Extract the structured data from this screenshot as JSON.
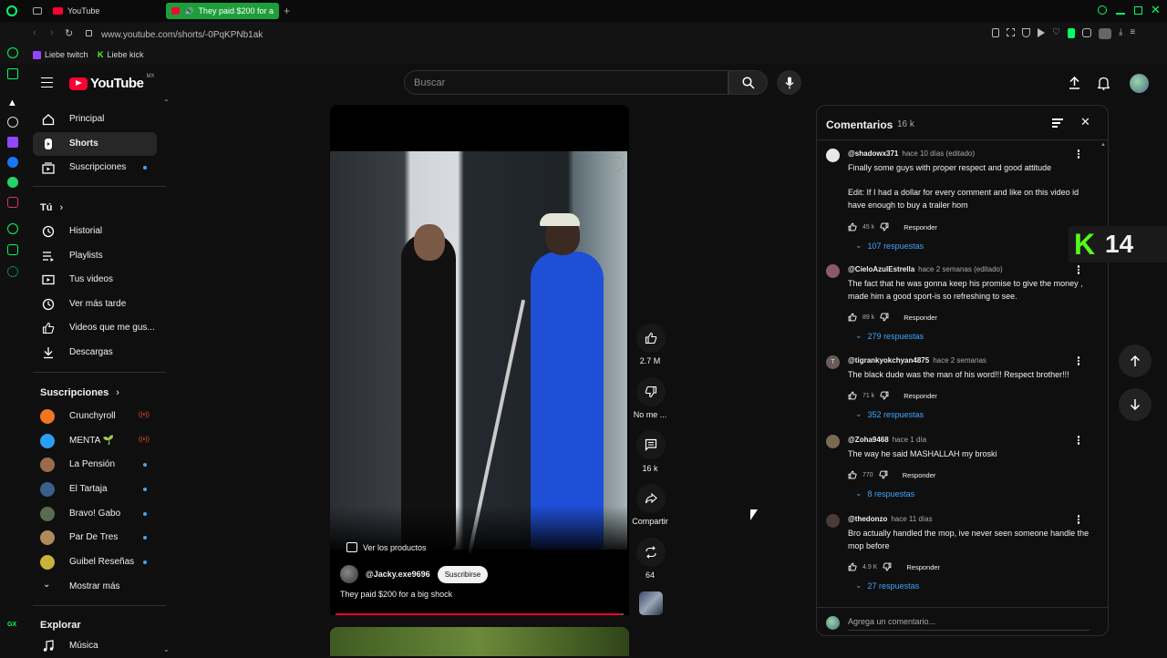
{
  "browser": {
    "tabs": [
      {
        "label": "YouTube",
        "active": false
      },
      {
        "label": "They paid $200 for a",
        "active": true
      }
    ],
    "url": "www.youtube.com/shorts/-0PqKPNb1ak",
    "bookmarks": [
      {
        "label": "Liebe twitch",
        "icon": "twitch-icon"
      },
      {
        "label": "Liebe kick",
        "icon": "kick-icon"
      }
    ],
    "accent": "#00ff66"
  },
  "header": {
    "logo": "YouTube",
    "region": "MX",
    "search_placeholder": "Buscar"
  },
  "sidebar": {
    "main": [
      {
        "label": "Principal",
        "icon": "home-icon"
      },
      {
        "label": "Shorts",
        "icon": "shorts-icon",
        "active": true
      },
      {
        "label": "Suscripciones",
        "icon": "subscriptions-icon"
      }
    ],
    "you_title": "Tú",
    "you": [
      {
        "label": "Historial",
        "icon": "history-icon"
      },
      {
        "label": "Playlists",
        "icon": "playlists-icon"
      },
      {
        "label": "Tus videos",
        "icon": "your-videos-icon"
      },
      {
        "label": "Ver más tarde",
        "icon": "watch-later-icon"
      },
      {
        "label": "Videos que me gus...",
        "icon": "liked-icon"
      },
      {
        "label": "Descargas",
        "icon": "downloads-icon"
      }
    ],
    "subs_title": "Suscripciones",
    "subs": [
      {
        "label": "Crunchyroll",
        "status": "live",
        "color": "#f47521"
      },
      {
        "label": "MENTA 🌱",
        "status": "live",
        "color": "#2a9df4"
      },
      {
        "label": "La Pensión",
        "status": "new",
        "color": "#9b6a4a"
      },
      {
        "label": "El Tartaja",
        "status": "new",
        "color": "#3a5f8a"
      },
      {
        "label": "Bravo! Gabo",
        "status": "new",
        "color": "#5a6b50"
      },
      {
        "label": "Par De Tres",
        "status": "new",
        "color": "#b08a5a"
      },
      {
        "label": "Guibel Reseñas",
        "status": "new",
        "color": "#c9b23a"
      }
    ],
    "show_more": "Mostrar más",
    "explore_title": "Explorar",
    "explore": [
      {
        "label": "Música",
        "icon": "music-icon"
      }
    ]
  },
  "short": {
    "shop_label": "Ver los productos",
    "channel": "@Jacky.exe9696",
    "subscribe": "Suscribirse",
    "title": "They paid $200 for a big shock",
    "progress": 0.99,
    "likes": "2.7 M",
    "dislike_label": "No me ...",
    "comments_count": "16 k",
    "share_label": "Compartir",
    "remix_count": "64"
  },
  "comments": {
    "title": "Comentarios",
    "count": "16 k",
    "placeholder": "Agrega un comentario...",
    "reply_label": "Responder",
    "items": [
      {
        "author": "@shadowx371",
        "time": "hace 10 días (editado)",
        "text": "Finally some guys with proper respect and good attitude\n\nEdit: If I had a dollar for every comment and like on this video id have enough to buy a trailer hom",
        "likes": "45 k",
        "replies": "107 respuestas",
        "avatar_color": "#e8e8e8"
      },
      {
        "author": "@CieloAzulEstrella",
        "time": "hace 2 semanas (editado)",
        "text": "The fact that he was gonna keep his promise to give the money , made him a good sport-is so refreshing to see.",
        "likes": "89 k",
        "replies": "279 respuestas",
        "avatar_color": "#8a5a6a"
      },
      {
        "author": "@tigrankyokchyan4875",
        "time": "hace 2 semanas",
        "text": "The black dude was the man of his word!!! Respect brother!!!",
        "likes": "71 k",
        "replies": "352 respuestas",
        "avatar_color": "#6a5a5a",
        "initial": "T"
      },
      {
        "author": "@Zoha9468",
        "time": "hace 1 día",
        "text": "The way he said MASHALLAH my broski",
        "likes": "770",
        "replies": "8 respuestas",
        "avatar_color": "#7a6a55"
      },
      {
        "author": "@thedonzo",
        "time": "hace 11 días",
        "text": "Bro actually handled the mop, ive never seen someone handle the mop before",
        "likes": "4.9 K",
        "replies": "27 respuestas",
        "avatar_color": "#4a3a3a"
      }
    ]
  },
  "overlay": {
    "kick_count": "14"
  }
}
